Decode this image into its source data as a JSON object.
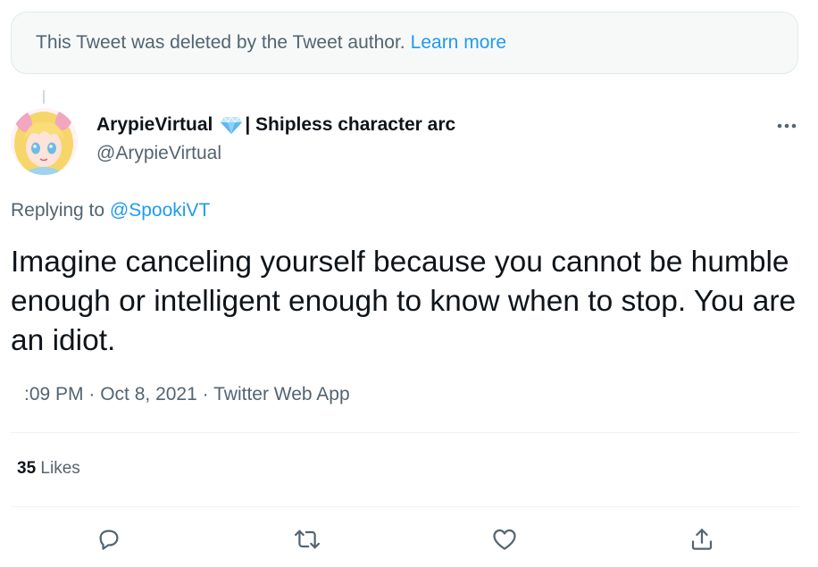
{
  "deleted_notice": {
    "text": "This Tweet was deleted by the Tweet author.",
    "link": "Learn more"
  },
  "author": {
    "display_name": "ArypieVirtual",
    "name_suffix": "| Shipless character arc",
    "handle": "@ArypieVirtual",
    "avatar_icon": "anime-avatar-icon",
    "badge_icon": "gem-icon"
  },
  "reply": {
    "prefix": "Replying to",
    "mention": "@SpookiVT"
  },
  "tweet": {
    "text": "Imagine canceling yourself because you cannot be humble enough or intelligent enough to know when to stop. You are an idiot."
  },
  "meta": {
    "time": ":09 PM",
    "separator1": "·",
    "date": "Oct 8, 2021",
    "separator2": "·",
    "source": "Twitter Web App"
  },
  "stats": {
    "likes_count": "35",
    "likes_label": "Likes"
  },
  "actions": [
    {
      "name": "reply",
      "icon": "comment-icon"
    },
    {
      "name": "retweet",
      "icon": "retweet-icon"
    },
    {
      "name": "like",
      "icon": "heart-icon"
    },
    {
      "name": "share",
      "icon": "share-icon"
    }
  ],
  "colors": {
    "link": "#1d9bf0",
    "text_primary": "#0f1419",
    "text_secondary": "#536471",
    "border": "#eff3f4"
  }
}
